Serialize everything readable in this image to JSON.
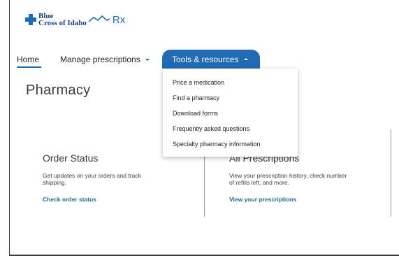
{
  "logo": {
    "line1": "Blue",
    "line2": "Cross of Idaho",
    "rx": "Rx"
  },
  "nav": {
    "home": "Home",
    "manage": "Manage prescriptions",
    "tools": "Tools & resources"
  },
  "page_title": "Pharmacy",
  "dropdown": {
    "items": [
      "Price a medication",
      "Find a pharmacy",
      "Download forms",
      "Frequently asked questions",
      "Specialty pharmacy information"
    ]
  },
  "cards": [
    {
      "title": "Order Status",
      "description": "Get updates on your orders and track shipping.",
      "link": "Check order status"
    },
    {
      "title": "All Prescriptions",
      "description": "View your prescription history, check number of refills left, and more.",
      "link": "View your prescriptions"
    }
  ],
  "colors": {
    "accent": "#1f6bb5",
    "link": "#1d6e8f",
    "text": "#333333"
  }
}
